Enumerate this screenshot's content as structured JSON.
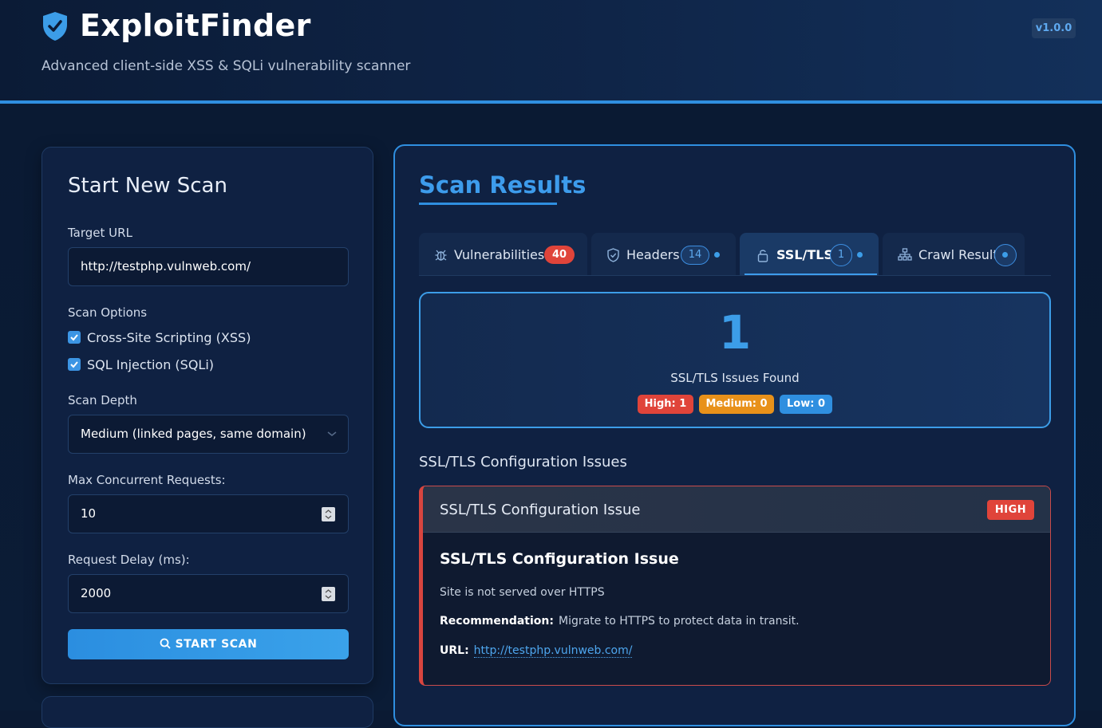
{
  "app": {
    "title": "ExploitFinder",
    "subtitle": "Advanced client-side XSS & SQLi vulnerability scanner",
    "version": "v1.0.0"
  },
  "scan_form": {
    "title": "Start New Scan",
    "target_url_label": "Target URL",
    "target_url_value": "http://testphp.vulnweb.com/",
    "scan_options_label": "Scan Options",
    "options": [
      {
        "label": "Cross-Site Scripting (XSS)",
        "checked": true
      },
      {
        "label": "SQL Injection (SQLi)",
        "checked": true
      }
    ],
    "scan_depth_label": "Scan Depth",
    "scan_depth_value": "Medium (linked pages, same domain)",
    "max_concurrent_label": "Max Concurrent Requests:",
    "max_concurrent_value": "10",
    "request_delay_label": "Request Delay (ms):",
    "request_delay_value": "2000",
    "start_button": "START SCAN"
  },
  "results": {
    "title": "Scan Results",
    "tabs": [
      {
        "label": "Vulnerabilities",
        "count": "40",
        "icon": "bug-icon"
      },
      {
        "label": "Headers",
        "count": "14",
        "icon": "shield-icon"
      },
      {
        "label": "SSL/TLS",
        "count": "1",
        "icon": "lock-icon",
        "active": true
      },
      {
        "label": "Crawl Results",
        "count": "",
        "icon": "sitemap-icon"
      }
    ],
    "summary": {
      "count": "1",
      "label": "SSL/TLS Issues Found",
      "high": "High: 1",
      "medium": "Medium: 0",
      "low": "Low: 0"
    },
    "section_title": "SSL/TLS Configuration Issues",
    "issue": {
      "header_title": "SSL/TLS Configuration Issue",
      "severity": "HIGH",
      "title": "SSL/TLS Configuration Issue",
      "description": "Site is not served over HTTPS",
      "recommendation_label": "Recommendation:",
      "recommendation": "Migrate to HTTPS to protect data in transit.",
      "url_label": "URL:",
      "url": "http://testphp.vulnweb.com/"
    }
  },
  "colors": {
    "accent": "#3c9de8",
    "high": "#e0443a",
    "medium": "#e8911a",
    "low": "#2f8fe0"
  }
}
